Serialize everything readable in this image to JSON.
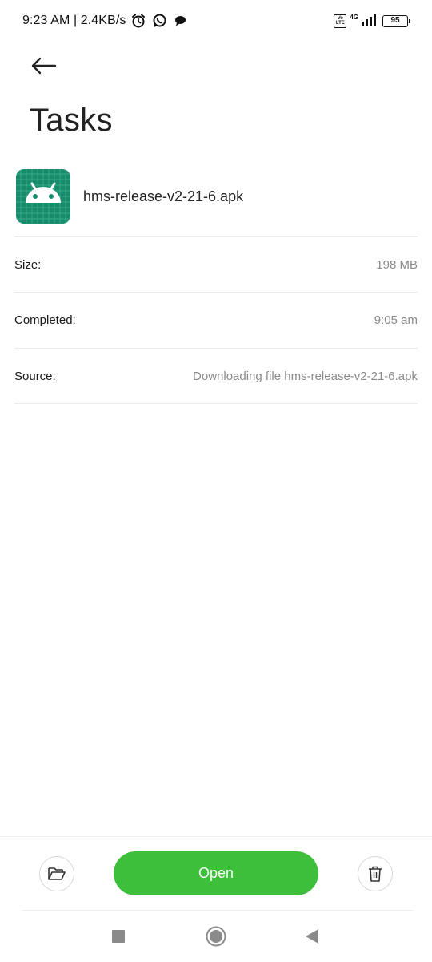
{
  "status_bar": {
    "time_speed": "9:23 AM | 2.4KB/s",
    "network_badge": "Vo LTE",
    "network_type": "4G",
    "battery": "95",
    "icons": [
      "alarm-icon",
      "whatsapp-icon",
      "chat-bubble-icon",
      "signal-icon"
    ]
  },
  "header": {
    "back_icon": "arrow-left-icon",
    "title": "Tasks"
  },
  "file": {
    "icon": "android-apk-icon",
    "name": "hms-release-v2-21-6.apk",
    "accent_color": "#1a8a6e"
  },
  "details": [
    {
      "label": "Size:",
      "value": "198 MB"
    },
    {
      "label": "Completed:",
      "value": "9:05 am"
    },
    {
      "label": "Source:",
      "value": "Downloading file hms-release-v2-21-6.apk"
    }
  ],
  "actions": {
    "folder_icon": "folder-open-icon",
    "open_label": "Open",
    "delete_icon": "trash-icon",
    "open_color": "#3dbf3b"
  },
  "nav": {
    "recents_icon": "square-icon",
    "home_icon": "circle-home-icon",
    "back_icon": "triangle-back-icon"
  }
}
